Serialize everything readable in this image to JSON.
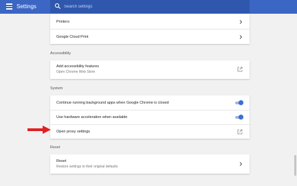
{
  "header": {
    "title": "Settings",
    "search_placeholder": "Search settings"
  },
  "printing": {
    "items": [
      {
        "label": "Printers"
      },
      {
        "label": "Google Cloud Print"
      }
    ]
  },
  "accessibility": {
    "title": "Accessibility",
    "item": {
      "label": "Add accessibility features",
      "sublabel": "Open Chrome Web Store"
    }
  },
  "system": {
    "title": "System",
    "items": [
      {
        "label": "Continue running background apps when Google Chrome is closed",
        "enabled": true
      },
      {
        "label": "Use hardware acceleration when available",
        "enabled": true
      },
      {
        "label": "Open proxy settings"
      }
    ]
  },
  "reset": {
    "title": "Reset",
    "item": {
      "label": "Reset",
      "sublabel": "Restore settings to their original defaults"
    }
  },
  "colors": {
    "header_bg": "#3b66c4",
    "toggle_on": "#3b6fd8",
    "annotation_arrow": "#e02020"
  }
}
